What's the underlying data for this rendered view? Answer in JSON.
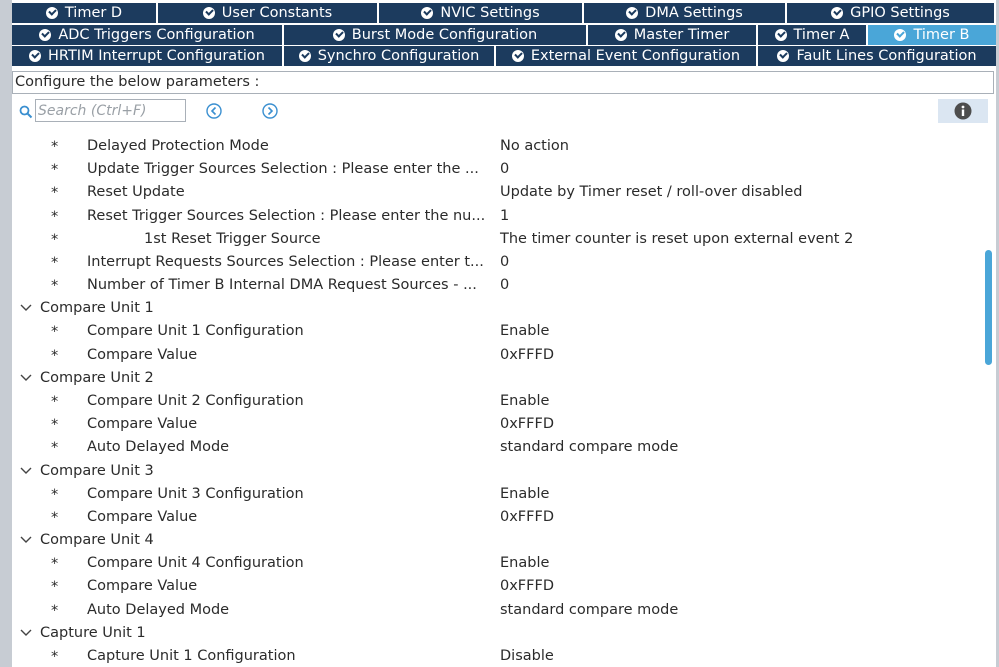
{
  "tabs": {
    "row1": [
      "Timer D",
      "User Constants",
      "NVIC Settings",
      "DMA Settings",
      "GPIO Settings"
    ],
    "row2": [
      "ADC Triggers Configuration",
      "Burst Mode Configuration",
      "Master Timer",
      "Timer A",
      "Timer B"
    ],
    "row3": [
      "HRTIM Interrupt Configuration",
      "Synchro Configuration",
      "External Event Configuration",
      "Fault Lines Configuration"
    ],
    "active": "Timer B"
  },
  "config_label": "Configure the below parameters :",
  "search": {
    "placeholder": "Search (Ctrl+F)"
  },
  "rows": [
    {
      "label": "Delayed Protection Mode",
      "value": "No action"
    },
    {
      "label": "Update Trigger Sources Selection : Please enter the ...",
      "value": "0"
    },
    {
      "label": "Reset Update",
      "value": "Update by Timer reset / roll-over disabled"
    },
    {
      "label": "Reset Trigger Sources Selection : Please enter the nu...",
      "value": "1"
    },
    {
      "label": "1st Reset Trigger Source",
      "value": "The timer counter is reset upon external event 2"
    },
    {
      "label": "Interrupt Requests Sources Selection : Please enter t...",
      "value": "0"
    },
    {
      "label": "Number of Timer B Internal DMA Request Sources  - ...",
      "value": "0"
    },
    {
      "group": "Compare Unit 1"
    },
    {
      "label": "Compare Unit 1 Configuration",
      "value": "Enable"
    },
    {
      "label": "Compare Value",
      "value": "0xFFFD"
    },
    {
      "group": "Compare Unit 2"
    },
    {
      "label": "Compare Unit 2 Configuration",
      "value": "Enable"
    },
    {
      "label": "Compare Value",
      "value": "0xFFFD"
    },
    {
      "label": "Auto Delayed Mode",
      "value": "standard compare mode"
    },
    {
      "group": "Compare Unit 3"
    },
    {
      "label": "Compare Unit 3 Configuration",
      "value": "Enable"
    },
    {
      "label": "Compare Value",
      "value": "0xFFFD"
    },
    {
      "group": "Compare Unit 4"
    },
    {
      "label": "Compare Unit 4 Configuration",
      "value": "Enable"
    },
    {
      "label": "Compare Value",
      "value": "0xFFFD"
    },
    {
      "label": "Auto Delayed Mode",
      "value": "standard compare mode"
    },
    {
      "group": "Capture Unit 1"
    },
    {
      "label": "Capture Unit 1 Configuration",
      "value": "Disable"
    }
  ],
  "colors": {
    "tab": "#1c3b5e",
    "tab_active": "#4aa6d8",
    "scroll_thumb": "#4aa6d8"
  }
}
